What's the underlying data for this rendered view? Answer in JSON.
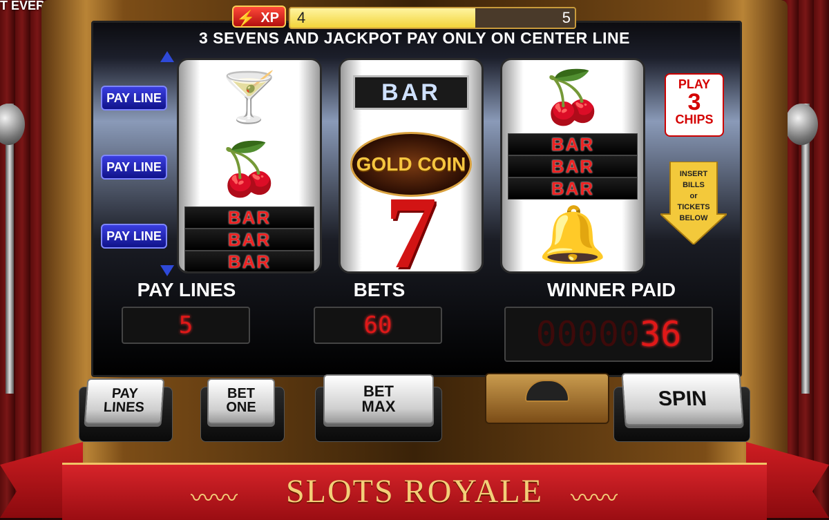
{
  "top_caption": "T EVER!",
  "xp": {
    "label": "XP",
    "current": "4",
    "max": "5",
    "progress_fraction": 0.65
  },
  "notice": "3 SEVENS AND JACKPOT PAY ONLY ON CENTER LINE",
  "pay_line_buttons": [
    "PAY LINE",
    "PAY LINE",
    "PAY LINE"
  ],
  "reels": [
    {
      "symbols": [
        "martini-icon",
        "cherries-icon",
        "bar",
        "bar",
        "bar"
      ],
      "bar_label": "BAR"
    },
    {
      "symbols": [
        "bar",
        "gold-coin",
        "seven"
      ],
      "bar_label": "BAR",
      "gold_coin_label": "GOLD COIN",
      "seven_label": "7"
    },
    {
      "symbols": [
        "cherries-icon",
        "bar",
        "bar",
        "bar",
        "bells-icon"
      ],
      "bar_label": "BAR"
    }
  ],
  "play_chips": {
    "line1": "PLAY",
    "line2": "3",
    "line3": "CHIPS"
  },
  "insert_notice": {
    "line1": "INSERT",
    "line2": "BILLS",
    "line3": "or",
    "line4": "TICKETS",
    "line5": "BELOW"
  },
  "counters": {
    "pay_lines": {
      "label": "PAY LINES",
      "value": "5"
    },
    "bets": {
      "label": "BETS",
      "value": "60"
    },
    "winner_paid": {
      "label": "WINNER PAID",
      "value": "36",
      "placeholder_digits": "00000"
    }
  },
  "buttons": {
    "pay_lines": {
      "line1": "PAY",
      "line2": "LINES"
    },
    "bet_one": {
      "line1": "BET",
      "line2": "ONE"
    },
    "bet_max": {
      "line1": "BET",
      "line2": "MAX"
    },
    "spin": "SPIN"
  },
  "banner_title": "SLOTS ROYALE",
  "colors": {
    "digit_red": "#e01818",
    "banner_red": "#c01a20",
    "gold": "#f3cf79",
    "payline_blue": "#1a1fb0"
  }
}
